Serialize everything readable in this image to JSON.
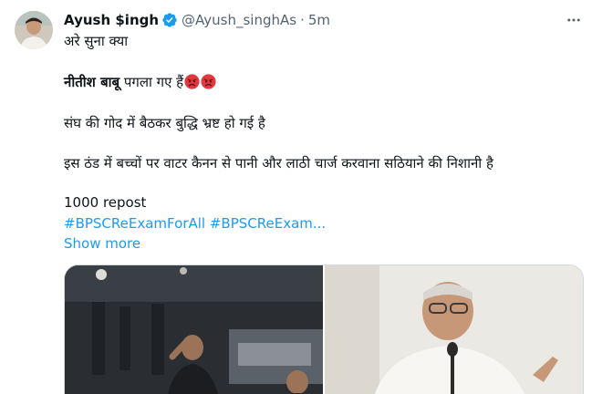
{
  "post": {
    "author": {
      "name": "Ayush $ingh",
      "handle": "@Ayush_singhAs",
      "verified": true
    },
    "separator": "·",
    "time": "5m",
    "lines": {
      "line1": "अरे सुना क्या",
      "line2_bold": "नीतीश बाबू",
      "line2_rest": " पगला गए हैं",
      "line3": "संघ की गोद में बैठकर बुद्धि भ्रष्ट हो गई है",
      "line4": "इस ठंड में बच्चों पर वाटर कैनन से पानी और लाठी चार्ज करवाना सठियाने की निशानी है",
      "line5": "1000 repost",
      "hashtags": "#BPSCReExamForAll #BPSCReExam...",
      "show_more": "Show more"
    },
    "icons": {
      "verified": "verified-badge-icon",
      "more": "more-dots-icon",
      "emoji": "angry-face-emoji"
    },
    "colors": {
      "accent": "#1d9bf0",
      "text": "#0f1419",
      "muted": "#536471"
    }
  }
}
